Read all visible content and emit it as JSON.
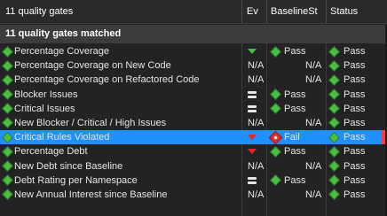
{
  "header": {
    "name_col": "11 quality gates",
    "ev_col": "Ev",
    "baseline_col": "BaselineSt",
    "status_col": "Status"
  },
  "group": {
    "label": "11 quality gates matched"
  },
  "rows": [
    {
      "name": "Percentage Coverage",
      "ev": "green-down-icon",
      "baseline": "Pass",
      "status": "Pass"
    },
    {
      "name": "Percentage Coverage on New Code",
      "ev": "N/A",
      "baseline": "N/A",
      "status": "Pass"
    },
    {
      "name": "Percentage Coverage on Refactored Code",
      "ev": "N/A",
      "baseline": "N/A",
      "status": "Pass"
    },
    {
      "name": "Blocker Issues",
      "ev": "equal-icon",
      "baseline": "Pass",
      "status": "Pass"
    },
    {
      "name": "Critical Issues",
      "ev": "equal-icon",
      "baseline": "Pass",
      "status": "Pass"
    },
    {
      "name": "New Blocker / Critical / High Issues",
      "ev": "N/A",
      "baseline": "N/A",
      "status": "Pass"
    },
    {
      "name": "Critical Rules Violated",
      "ev": "red-down-icon",
      "baseline": "Fail",
      "status": "Pass",
      "selected": true
    },
    {
      "name": "Percentage Debt",
      "ev": "red-down-icon",
      "baseline": "Pass",
      "status": "Pass"
    },
    {
      "name": "New Debt since Baseline",
      "ev": "N/A",
      "baseline": "N/A",
      "status": "Pass"
    },
    {
      "name": "Debt Rating per Namespace",
      "ev": "equal-icon",
      "baseline": "Pass",
      "status": "Pass"
    },
    {
      "name": "New Annual Interest since Baseline",
      "ev": "N/A",
      "baseline": "N/A",
      "status": "Pass"
    }
  ],
  "colors": {
    "pass": "#4bbf45",
    "fail": "#d9312f",
    "selection": "#1e90ff"
  }
}
